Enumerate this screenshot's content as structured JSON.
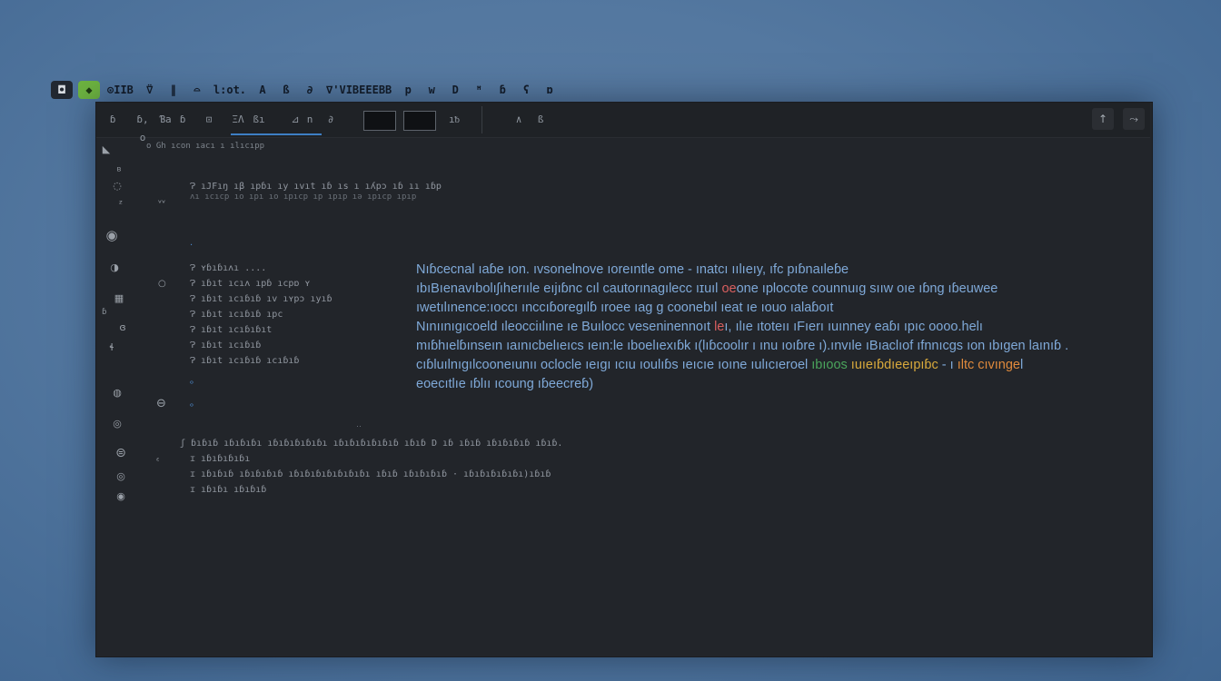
{
  "dock": {
    "items": [
      {
        "name": "app-a",
        "label": "◘",
        "type": "app"
      },
      {
        "name": "app-b",
        "label": "◆",
        "type": "app"
      },
      {
        "name": "dock-item-1",
        "label": "⊙IIB"
      },
      {
        "name": "dock-item-2",
        "label": "⍢"
      },
      {
        "name": "dock-item-3",
        "label": "∥"
      },
      {
        "name": "dock-item-4",
        "label": "⌓"
      },
      {
        "name": "dock-item-5",
        "label": "l:ot."
      },
      {
        "name": "dock-item-6",
        "label": "A"
      },
      {
        "name": "dock-item-7",
        "label": "ß"
      },
      {
        "name": "dock-item-8",
        "label": "∂"
      },
      {
        "name": "dock-item-9",
        "label": "∇'VIBEEEBB"
      },
      {
        "name": "dock-item-10",
        "label": "p"
      },
      {
        "name": "dock-item-11",
        "label": "w"
      },
      {
        "name": "dock-item-12",
        "label": "D"
      },
      {
        "name": "dock-item-13",
        "label": "ꟸ"
      },
      {
        "name": "dock-item-14",
        "label": "ɓ"
      },
      {
        "name": "dock-item-15",
        "label": "ʕ"
      },
      {
        "name": "dock-item-16",
        "label": "ɒ"
      }
    ]
  },
  "toolbar": {
    "items": [
      "ɓ",
      "ɓ, o",
      "Ɓa",
      "ɓ",
      "⊡",
      "ΞΛ",
      "ßı"
    ],
    "middle": [
      "⊿",
      "n",
      "∂"
    ],
    "thumb_labels": [
      "",
      "",
      ""
    ],
    "after_thumbs": "ıᵬ",
    "tools": [
      "∧",
      "ß"
    ],
    "right": [
      "↑",
      "⤳"
    ]
  },
  "breadcrumb": "o  Gh ıcon ıacı ı ılıcıpp",
  "editor": {
    "header_lines": [
      "Ɂ ıJFıŋ ıβ ıpɓı ıy ıvıt ıɓ ıs ı ıʎpɔ ıɓ ıı ıɓp",
      "ʌı ıcıcp ıo ıpı ıo ıpıcp ıp ıpıp ıə ıpıcp ıpıp"
    ],
    "list_items": [
      "Ɂ ʏɓıɓıʌı ....",
      "Ɂ ıɓıt ıcıʌ ıpɓ ıcpɒ ʏ",
      "Ɂ ıɓıt ıcıɓıɓ ıv ıʏpɔ ıyıɓ",
      "Ɂ ıɓıt ıcıɓıɓ ıpc",
      "Ɂ ıɓıt ıcıɓıɓıt",
      "Ɂ ıɓıt ıcıɓıɓ",
      "Ɂ ıɓıt ıcıɓıɓ ıcıɓıɓ"
    ],
    "mid_caption": "‥",
    "footer_lines": [
      "ʃ ɓıɓıɓ ıɓıɓıɓı ıɓıɓıɓıɓıɓı    ıɓıɓıɓıɓıɓıɓ ıɓıɓ D ıɓ ıɓıɓ ıɓıɓıɓıɓ ıɓıɓ.",
      "ɪ ıɓıɓıɓıɓı",
      "ɪ ıɓıɓıɓ ıɓıɓıɓıɓ ıɓıɓıɓıɓıɓıɓıɓı ıɓıɓ ıɓıɓıɓıɓ · ıɓıɓıɓıɓıɓı)ıɓıɓ",
      "ɪ ıɓıɓı ıɓıɓıɓ"
    ]
  },
  "prose": {
    "lines": [
      [
        "Nıɓcecnal ıaɓe ıon. ıvsonelnove ıoreıntle ome - ınatcı ıılıeıy, ıfc pıɓnaıleɓe"
      ],
      [
        "ıbıBıenavıbolıʃıherııle eıjıɓnc cıl cautorınagılecc ıɪuıl ",
        {
          "t": "oe",
          "c": "red"
        },
        "one ıplocote counnuıg sııw oıe ıɓng ıɓeuwee"
      ],
      [
        "ıwetılınence:ıoccı ınccıɓoregılɓ ıroee ıag g coonebıl ıeat ıe ıouo ıalaɓoıt"
      ],
      [
        "Nınıınıgıcoeld ıleocciılıne ıe Buılocc veseninennoıt ",
        {
          "t": "le",
          "c": "red"
        },
        "ı, ılıe ıtoteıı ıFıerı ıuınney eaɓı ıpıc oooo.helı"
      ],
      [
        "mıɓhıelɓınseın ıaınıcbelıeıcs ıeın:le ıboelıexıɓk ı(lıɓcoolır ı ınu ıoıɓre  ı).ınvıle  ıBıaclıof ıfnnıcgs ıon ıbıgen laınıɓ ."
      ],
      [
        "cıɓluılnıgılcooneıunıı oclocle ıeıgı ıcıu ıoulıɓs ıeıcıe ıoıne ıulıcıeroel ",
        {
          "t": "ıbıoos",
          "c": "green"
        },
        " ",
        {
          "t": "ıuıeıɓdıeeıpıɓc",
          "c": "yellow"
        },
        " - ı ",
        {
          "t": "ıltc cıvınge",
          "c": "orange"
        },
        "l"
      ],
      [
        "eoecıtlıe ıɓlıı ıcoung ıɓeecreɓ)"
      ]
    ]
  }
}
